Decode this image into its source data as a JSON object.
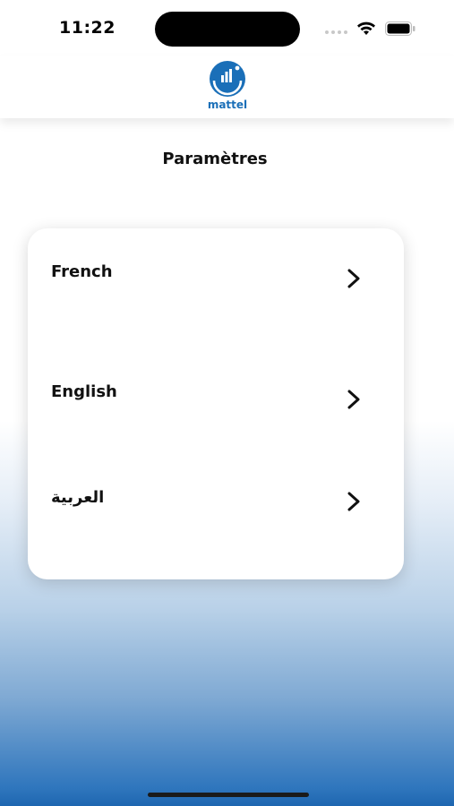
{
  "status_bar": {
    "time": "11:22"
  },
  "header": {
    "logo_icon": "mattel-logo",
    "logo_text": "mattel",
    "brand_color": "#1a6fb8"
  },
  "page": {
    "title": "Paramètres"
  },
  "languages": [
    {
      "label": "French"
    },
    {
      "label": "English"
    },
    {
      "label": "العربية"
    }
  ],
  "icons": {
    "row_arrow": "chevron-right-icon"
  },
  "colors": {
    "background_gradient_bottom": "#1e66b0",
    "card": "#ffffff"
  }
}
